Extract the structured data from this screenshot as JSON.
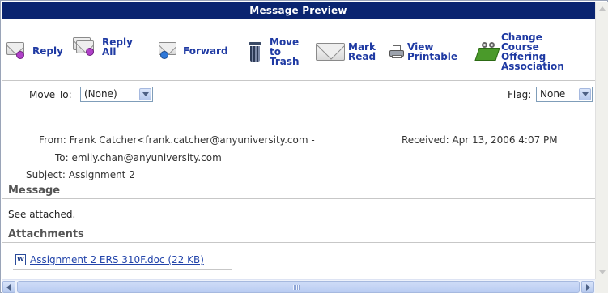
{
  "window": {
    "title": "Message Preview"
  },
  "toolbar": {
    "reply": {
      "label": "Reply",
      "icon": "reply-envelope-icon"
    },
    "reply_all": {
      "line1": "Reply",
      "line2": "All",
      "icon": "reply-all-envelope-icon"
    },
    "forward": {
      "label": "Forward",
      "icon": "forward-envelope-icon"
    },
    "move_to_trash": {
      "line1": "Move",
      "line2": "to",
      "line3": "Trash",
      "icon": "trash-icon"
    },
    "mark_read": {
      "line1": "Mark",
      "line2": "Read",
      "icon": "envelope-icon"
    },
    "view_printable": {
      "line1": "View",
      "line2": "Printable",
      "icon": "printer-icon"
    },
    "change_course": {
      "line1": "Change",
      "line2": "Course",
      "line3": "Offering",
      "line4": "Association",
      "icon": "book-glasses-icon"
    }
  },
  "move_bar": {
    "move_to_label": "Move To:",
    "move_to_value": "(None)",
    "flag_label": "Flag:",
    "flag_value": "None"
  },
  "message": {
    "from_label": "From:",
    "from_value": "Frank Catcher<frank.catcher@anyuniversity.com -",
    "received_label": "Received:",
    "received_value": "Apr 13, 2006 4:07 PM",
    "to_label": "To:",
    "to_value": "emily.chan@anyuniversity.com",
    "subject_label": "Subject:",
    "subject_value": "Assignment 2",
    "message_heading": "Message",
    "body": "See attached.",
    "attachments_heading": "Attachments",
    "attachment_name": "Assignment 2 ERS 310F.doc (22 KB)",
    "attachment_icon_letter": "W"
  },
  "colors": {
    "title_bar": "#0a2470",
    "link": "#1f3aa3"
  }
}
